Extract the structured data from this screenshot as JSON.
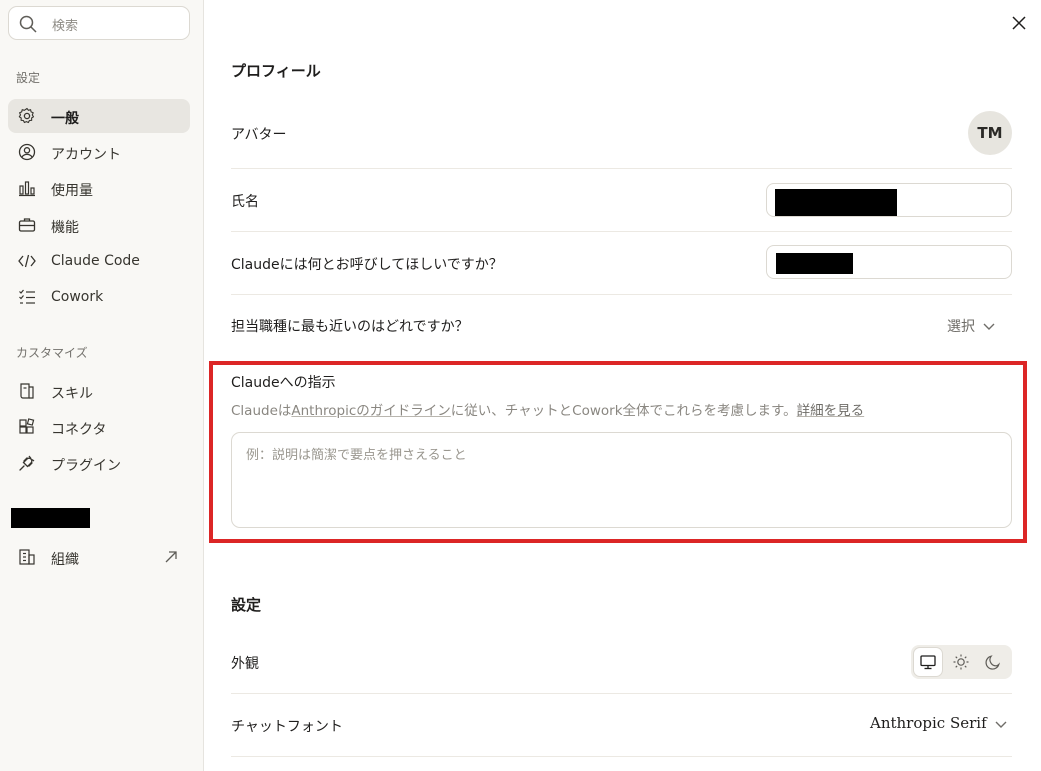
{
  "sidebar": {
    "search": {
      "icon": "search-icon",
      "placeholder": "検索"
    },
    "settings_label": "設定",
    "items": [
      {
        "label": "一般",
        "icon": "gear-icon",
        "active": true
      },
      {
        "label": "アカウント",
        "icon": "user-circle-icon"
      },
      {
        "label": "使用量",
        "icon": "bar-chart-icon"
      },
      {
        "label": "機能",
        "icon": "briefcase-icon"
      },
      {
        "label": "Claude Code",
        "icon": "code-icon"
      },
      {
        "label": "Cowork",
        "icon": "checklist-icon"
      }
    ],
    "customize_label": "カスタマイズ",
    "customize_items": [
      {
        "label": "スキル",
        "icon": "skill-icon"
      },
      {
        "label": "コネクタ",
        "icon": "connector-icon"
      },
      {
        "label": "プラグイン",
        "icon": "plug-icon"
      }
    ],
    "org_item": {
      "label": "組織",
      "icon": "building-icon",
      "external_icon": "arrow-up-right-icon"
    }
  },
  "profile": {
    "heading": "プロフィール",
    "avatar_label": "アバター",
    "avatar_initials": "TM",
    "full_name_label": "氏名",
    "nickname_label": "Claudeには何とお呼びしてほしいですか？",
    "role_label": "担当職種に最も近いのはどれですか？",
    "role_select": "選択"
  },
  "instructions": {
    "title": "Claudeへの指示",
    "desc_pre": "Claudeは",
    "desc_link": "Anthropicのガイドライン",
    "desc_post": "に従い、チャットとCowork全体でこれらを考慮します。",
    "desc_more": "詳細を見る",
    "placeholder": "例：説明は簡潔で要点を押さえること"
  },
  "settings": {
    "heading": "設定",
    "appearance_label": "外観",
    "appearance_options": [
      "monitor-icon",
      "sun-icon",
      "moon-icon"
    ],
    "chat_font_label": "チャットフォント",
    "chat_font_value": "Anthropic Serif"
  },
  "colors": {
    "highlight": "#dc2626",
    "active_bg": "#e8e6e1",
    "sidebar_bg": "#f9f8f5"
  }
}
